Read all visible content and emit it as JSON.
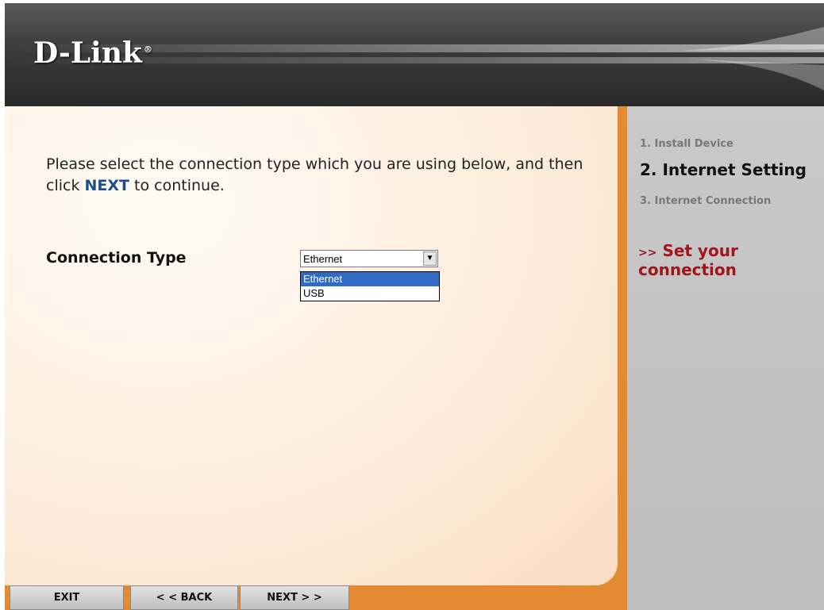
{
  "header": {
    "logo_text": "D-Link",
    "logo_mark": "®"
  },
  "main": {
    "instruction_pre": "Please select the connection type which you are using below, and then click ",
    "instruction_keyword": "NEXT",
    "instruction_post": " to continue.",
    "connection_type_label": "Connection Type",
    "select": {
      "value": "Ethernet",
      "arrow_icon": "▼",
      "options": [
        "Ethernet",
        "USB"
      ],
      "highlighted_option": "Ethernet"
    }
  },
  "sidebar": {
    "steps": [
      {
        "label": "1. Install Device",
        "state": "done"
      },
      {
        "label": "2.  Internet Setting",
        "state": "current"
      },
      {
        "label": "3.  Internet Connection",
        "state": "pending"
      }
    ],
    "hint_arrows": ">>",
    "hint_text": "Set your  connection"
  },
  "footer": {
    "exit_label": "EXIT",
    "back_label": "< < BACK",
    "next_label": "NEXT > >"
  },
  "colors": {
    "accent_orange": "#e38a33",
    "keyword_blue": "#1d4e8c",
    "hint_red": "#a0151c",
    "selection_blue": "#316ac5"
  }
}
